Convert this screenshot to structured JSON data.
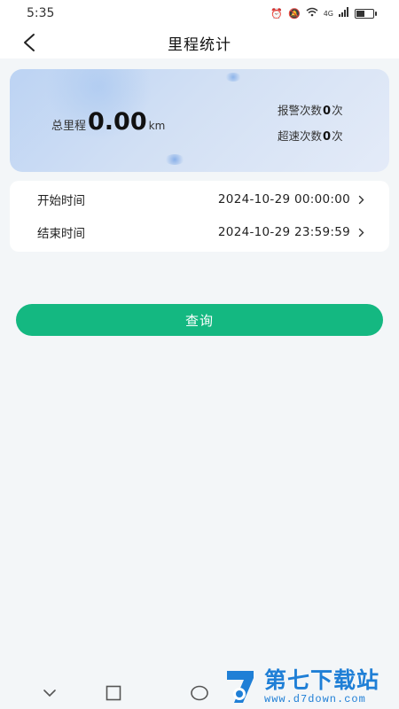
{
  "status_bar": {
    "time": "5:35",
    "signal": "4G",
    "battery_level": 0.55
  },
  "header": {
    "title": "里程统计"
  },
  "summary": {
    "total_label": "总里程",
    "total_value": "0.00",
    "total_unit": "km",
    "alarm_label": "报警次数",
    "alarm_count": "0",
    "alarm_unit": "次",
    "speeding_label": "超速次数",
    "speeding_count": "0",
    "speeding_unit": "次"
  },
  "time_range": {
    "start_label": "开始时间",
    "start_value": "2024-10-29 00:00:00",
    "end_label": "结束时间",
    "end_value": "2024-10-29 23:59:59"
  },
  "actions": {
    "query_label": "查询"
  },
  "watermark": {
    "title": "第七下载站",
    "url": "www.d7down.com"
  },
  "colors": {
    "accent": "#14b881",
    "card_gradient_start": "#bcd3f3",
    "watermark": "#1f7fd6"
  }
}
